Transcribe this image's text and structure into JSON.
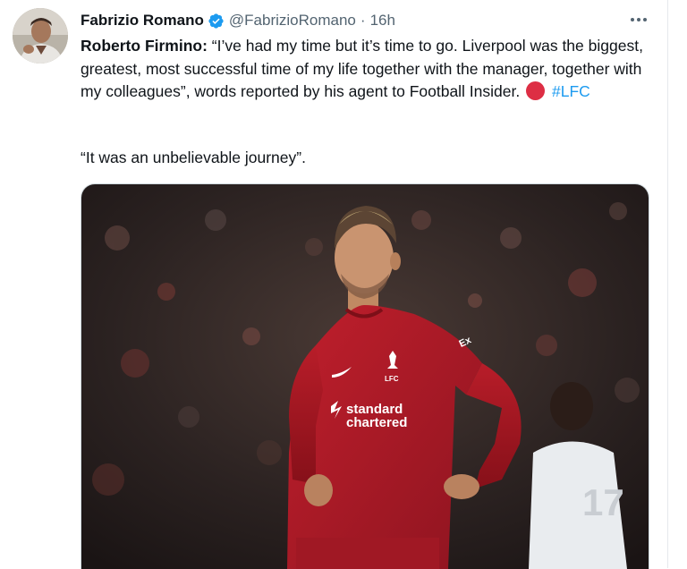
{
  "author": {
    "display_name": "Fabrizio Romano",
    "handle": "@FabrizioRomano",
    "separator": "·",
    "time": "16h",
    "verified": true,
    "verified_color": "#1d9bf0"
  },
  "menu": {
    "more_icon": "more-horizontal-icon",
    "label": "•••"
  },
  "tweet": {
    "lead": "Roberto Firmino:",
    "body": " “I’ve had my time but it’s time to go. Liverpool was the biggest, greatest, most successful time of my life together with the manager, together with my colleagues”, words reported by his agent to Football Insider.",
    "emoji": "red-circle",
    "emoji_color": "#dd2e44",
    "hashtag": "#LFC",
    "quote": "“It was an unbelievable journey”.",
    "hashtag_color": "#1d9bf0"
  },
  "media": {
    "type": "photo",
    "shirt_sponsor": "standard\nchartered",
    "sponsor_line1": "standard",
    "sponsor_line2": "chartered",
    "crest_text": "LFC",
    "background_number": "17"
  }
}
